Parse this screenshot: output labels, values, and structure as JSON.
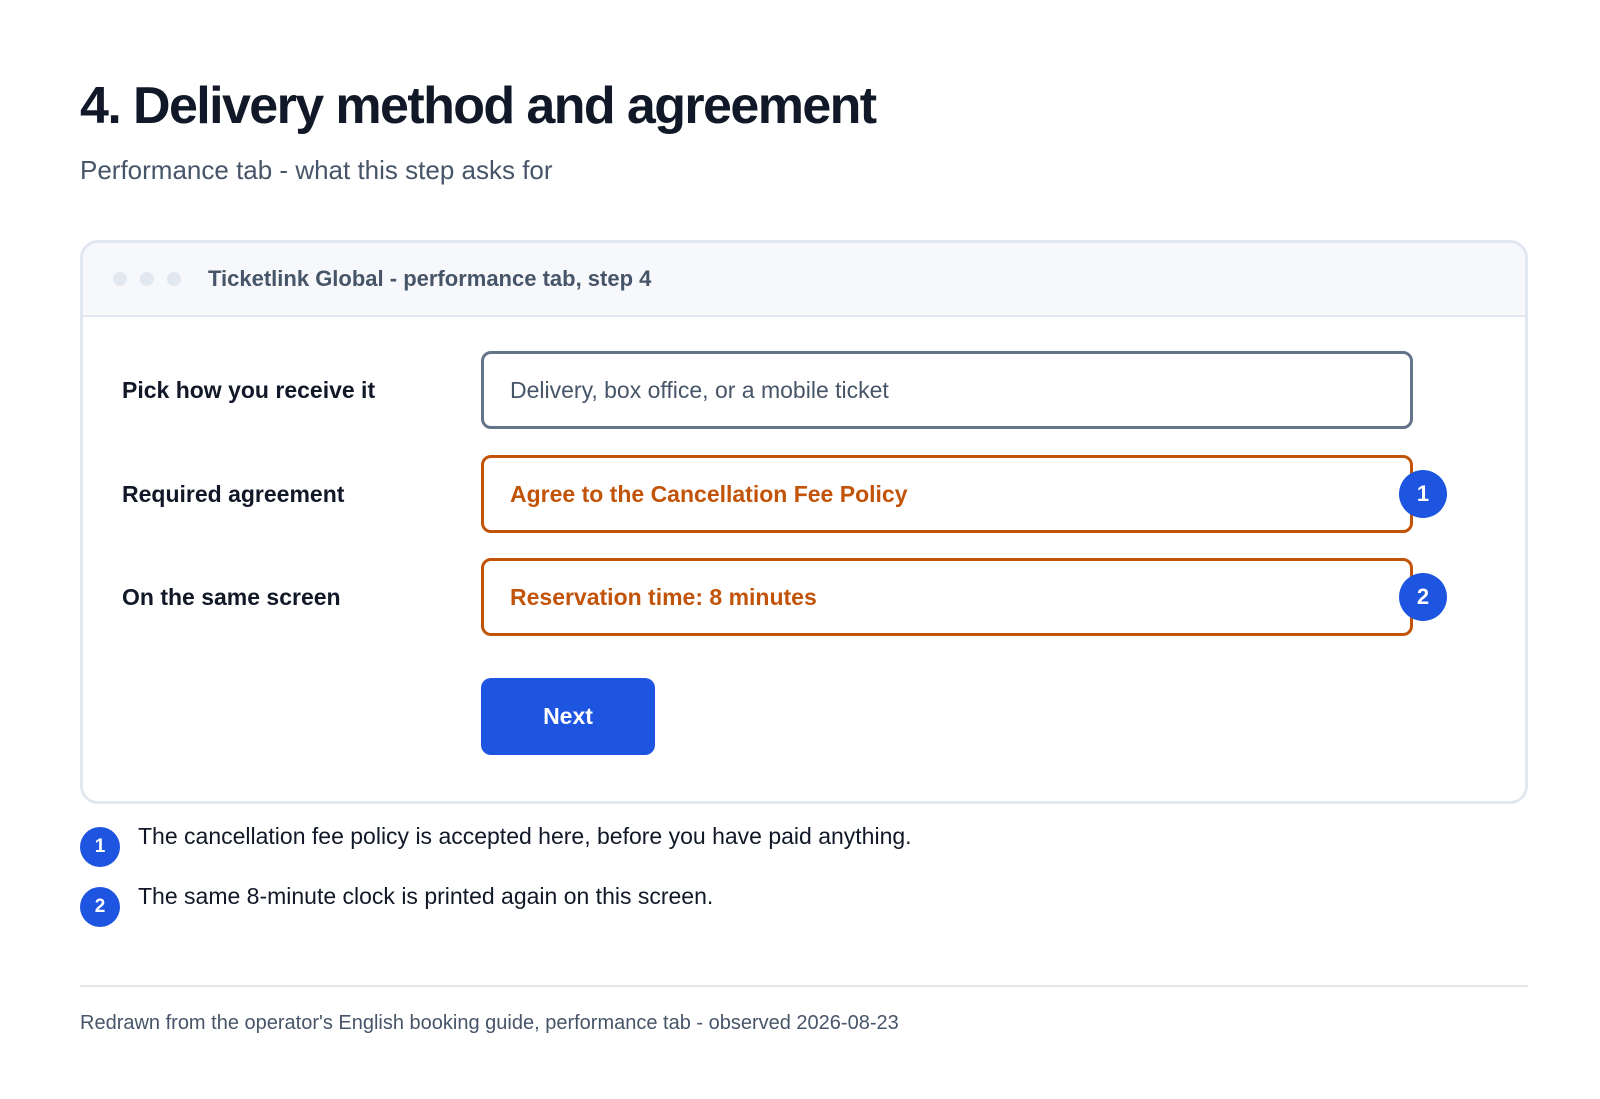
{
  "header": {
    "title": "4. Delivery method and agreement",
    "subtitle": "Performance tab - what this step asks for"
  },
  "window": {
    "title": "Ticketlink Global - performance tab, step 4"
  },
  "form": {
    "rows": [
      {
        "label": "Pick how you receive it",
        "field": "Delivery, box office, or a mobile ticket",
        "style": "neutral"
      },
      {
        "label": "Required agreement",
        "field": "Agree to the Cancellation Fee Policy",
        "style": "warn",
        "badge": "1"
      },
      {
        "label": "On the same screen",
        "field": "Reservation time: 8 minutes",
        "style": "warn",
        "badge": "2"
      }
    ],
    "next_label": "Next"
  },
  "notes": [
    {
      "badge": "1",
      "text": "The cancellation fee policy is accepted here, before you have paid anything."
    },
    {
      "badge": "2",
      "text": "The same 8-minute clock is printed again on this screen."
    }
  ],
  "footer": {
    "text": "Redrawn from the operator's English booking guide, performance tab - observed 2026-08-23"
  },
  "colors": {
    "accent": "#1d54e0",
    "warning": "#c2540a",
    "border": "#e2e8f0",
    "text": "#111827",
    "muted": "#475569"
  },
  "icons": [
    "window-dot-icon",
    "annotation-badge-icon"
  ]
}
